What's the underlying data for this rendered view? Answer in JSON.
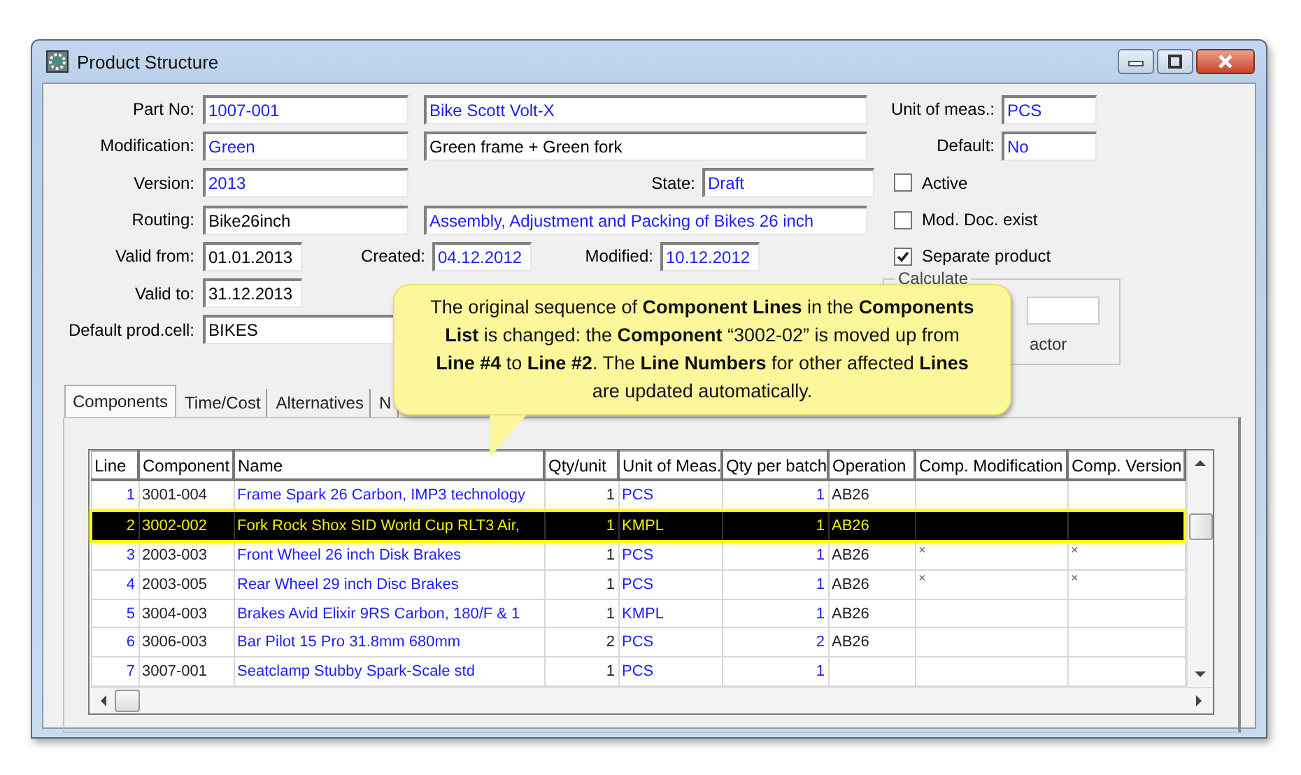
{
  "window": {
    "title": "Product Structure"
  },
  "form": {
    "part_no": {
      "label": "Part No:",
      "value": "1007-001",
      "kind": "lookup"
    },
    "part_description": {
      "value": "Bike Scott Volt-X",
      "kind": "lookup"
    },
    "modification": {
      "label": "Modification:",
      "value": "Green",
      "kind": "lookup"
    },
    "modification_description": {
      "value": "Green frame + Green fork",
      "kind": "input"
    },
    "version": {
      "label": "Version:",
      "value": "2013",
      "kind": "lookup"
    },
    "state": {
      "label": "State:",
      "value": "Draft",
      "kind": "lookup"
    },
    "routing": {
      "label": "Routing:",
      "value": "Bike26inch",
      "kind": "input"
    },
    "routing_description": {
      "value": "Assembly, Adjustment and Packing of Bikes 26 inch",
      "kind": "lookup"
    },
    "valid_from": {
      "label": "Valid from:",
      "value": "01.01.2013",
      "kind": "input"
    },
    "created": {
      "label": "Created:",
      "value": "04.12.2012",
      "kind": "lookup"
    },
    "modified": {
      "label": "Modified:",
      "value": "10.12.2012",
      "kind": "lookup"
    },
    "valid_to": {
      "label": "Valid to:",
      "value": "31.12.2013",
      "kind": "input"
    },
    "default_prod_cell": {
      "label": "Default prod.cell:",
      "value": "BIKES",
      "kind": "input"
    },
    "unit_of_meas": {
      "label": "Unit of meas.:",
      "value": "PCS",
      "kind": "lookup"
    },
    "default": {
      "label": "Default:",
      "value": "No",
      "kind": "lookup"
    }
  },
  "checkboxes": [
    {
      "label": "Active",
      "checked": false
    },
    {
      "label": "Mod. Doc. exist",
      "checked": false
    },
    {
      "label": "Separate product",
      "checked": true
    }
  ],
  "calculate_group": {
    "title": "Calculate",
    "label_fragment": "actor"
  },
  "callout": {
    "text": "The original sequence of **Component Lines** in the **Components List** is changed: the **Component**  “3002-02” is moved up from **Line #4** to **Line #2**. The **Line Numbers** for other affected **Lines** are updated automatically."
  },
  "tabs": [
    {
      "label": "Components",
      "selected": true
    },
    {
      "label": "Time/Cost",
      "selected": false
    },
    {
      "label": "Alternatives",
      "selected": false
    },
    {
      "label": "N",
      "selected": false
    }
  ],
  "table": {
    "columns": [
      "Line",
      "Component",
      "Name",
      "Qty/unit",
      "Unit of Meas.",
      "Qty per batch",
      "Operation",
      "Comp. Modification",
      "Comp. Version"
    ],
    "rows": [
      {
        "line": "1",
        "component": "3001-004",
        "name": "Frame Spark 26 Carbon, IMP3 technology",
        "qty_unit": "1",
        "unit": "PCS",
        "qty_batch": "1",
        "operation": "AB26",
        "selected": false
      },
      {
        "line": "2",
        "component": "3002-002",
        "name": "Fork Rock Shox SID World Cup RLT3 Air,",
        "qty_unit": "1",
        "unit": "KMPL",
        "qty_batch": "1",
        "operation": "AB26",
        "selected": true
      },
      {
        "line": "3",
        "component": "2003-003",
        "name": "Front Wheel 26 inch Disk Brakes",
        "qty_unit": "1",
        "unit": "PCS",
        "qty_batch": "1",
        "operation": "AB26",
        "comp_modification": "×",
        "comp_version": "×",
        "selected": false
      },
      {
        "line": "4",
        "component": "2003-005",
        "name": "Rear Wheel 29 inch Disc Brakes",
        "qty_unit": "1",
        "unit": "PCS",
        "qty_batch": "1",
        "operation": "AB26",
        "comp_modification": "×",
        "comp_version": "×",
        "selected": false
      },
      {
        "line": "5",
        "component": "3004-003",
        "name": "Brakes Avid Elixir 9RS Carbon, 180/F & 1",
        "qty_unit": "1",
        "unit": "KMPL",
        "qty_batch": "1",
        "operation": "AB26",
        "selected": false
      },
      {
        "line": "6",
        "component": "3006-003",
        "name": "Bar Pilot 15 Pro 31.8mm 680mm",
        "qty_unit": "2",
        "unit": "PCS",
        "qty_batch": "2",
        "operation": "AB26",
        "selected": false
      },
      {
        "line": "7",
        "component": "3007-001",
        "name": "Seatclamp Stubby Spark-Scale std",
        "qty_unit": "1",
        "unit": "PCS",
        "qty_batch": "1",
        "selected": false
      }
    ]
  }
}
